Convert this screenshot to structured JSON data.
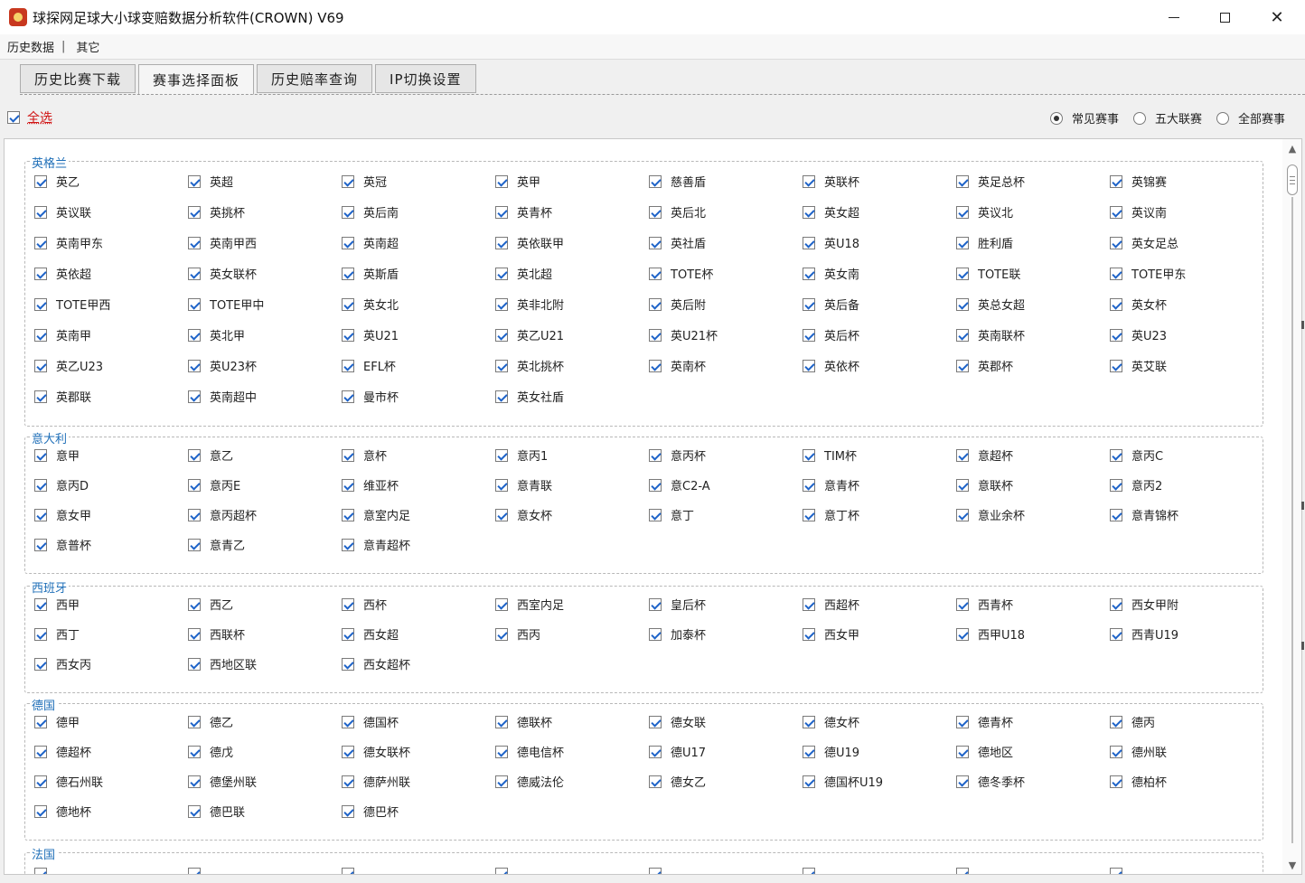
{
  "window": {
    "title": "球探网足球大小球变赔数据分析软件(CROWN) V69"
  },
  "menu": {
    "items": [
      "历史数据",
      "其它"
    ],
    "separator": "|"
  },
  "tabs": [
    {
      "label": "历史比赛下载",
      "active": false
    },
    {
      "label": "赛事选择面板",
      "active": true
    },
    {
      "label": "历史赔率查询",
      "active": false
    },
    {
      "label": "IP切换设置",
      "active": false
    }
  ],
  "select_all": {
    "label": "全选",
    "checked": true
  },
  "filter": {
    "options": [
      {
        "label": "常见赛事",
        "selected": true
      },
      {
        "label": "五大联赛",
        "selected": false
      },
      {
        "label": "全部赛事",
        "selected": false
      }
    ]
  },
  "colors": {
    "group_label": "#1f6fb8",
    "select_all": "#d01414",
    "check": "#1e63c8"
  },
  "groups": [
    {
      "name": "英格兰",
      "items": [
        "英乙",
        "英超",
        "英冠",
        "英甲",
        "慈善盾",
        "英联杯",
        "英足总杯",
        "英锦赛",
        "英议联",
        "英挑杯",
        "英后南",
        "英青杯",
        "英后北",
        "英女超",
        "英议北",
        "英议南",
        "英南甲东",
        "英南甲西",
        "英南超",
        "英依联甲",
        "英社盾",
        "英U18",
        "胜利盾",
        "英女足总",
        "英依超",
        "英女联杯",
        "英斯盾",
        "英北超",
        "TOTE杯",
        "英女南",
        "TOTE联",
        "TOTE甲东",
        "TOTE甲西",
        "TOTE甲中",
        "英女北",
        "英非北附",
        "英后附",
        "英后备",
        "英总女超",
        "英女杯",
        "英南甲",
        "英北甲",
        "英U21",
        "英乙U21",
        "英U21杯",
        "英后杯",
        "英南联杯",
        "英U23",
        "英乙U23",
        "英U23杯",
        "EFL杯",
        "英北挑杯",
        "英南杯",
        "英依杯",
        "英郡杯",
        "英艾联",
        "英郡联",
        "英南超中",
        "曼市杯",
        "英女社盾"
      ]
    },
    {
      "name": "意大利",
      "items": [
        "意甲",
        "意乙",
        "意杯",
        "意丙1",
        "意丙杯",
        "TIM杯",
        "意超杯",
        "意丙C",
        "意丙D",
        "意丙E",
        "维亚杯",
        "意青联",
        "意C2-A",
        "意青杯",
        "意联杯",
        "意丙2",
        "意女甲",
        "意丙超杯",
        "意室内足",
        "意女杯",
        "意丁",
        "意丁杯",
        "意业余杯",
        "意青锦杯",
        "意普杯",
        "意青乙",
        "意青超杯"
      ]
    },
    {
      "name": "西班牙",
      "items": [
        "西甲",
        "西乙",
        "西杯",
        "西室内足",
        "皇后杯",
        "西超杯",
        "西青杯",
        "西女甲附",
        "西丁",
        "西联杯",
        "西女超",
        "西丙",
        "加泰杯",
        "西女甲",
        "西甲U18",
        "西青U19",
        "西女丙",
        "西地区联",
        "西女超杯"
      ]
    },
    {
      "name": "德国",
      "items": [
        "德甲",
        "德乙",
        "德国杯",
        "德联杯",
        "德女联",
        "德女杯",
        "德青杯",
        "德丙",
        "德超杯",
        "德戊",
        "德女联杯",
        "德电信杯",
        "德U17",
        "德U19",
        "德地区",
        "德州联",
        "德石州联",
        "德堡州联",
        "德萨州联",
        "德威法伦",
        "德女乙",
        "德国杯U19",
        "德冬季杯",
        "德柏杯",
        "德地杯",
        "德巴联",
        "德巴杯"
      ]
    },
    {
      "name": "法国",
      "items": []
    }
  ]
}
